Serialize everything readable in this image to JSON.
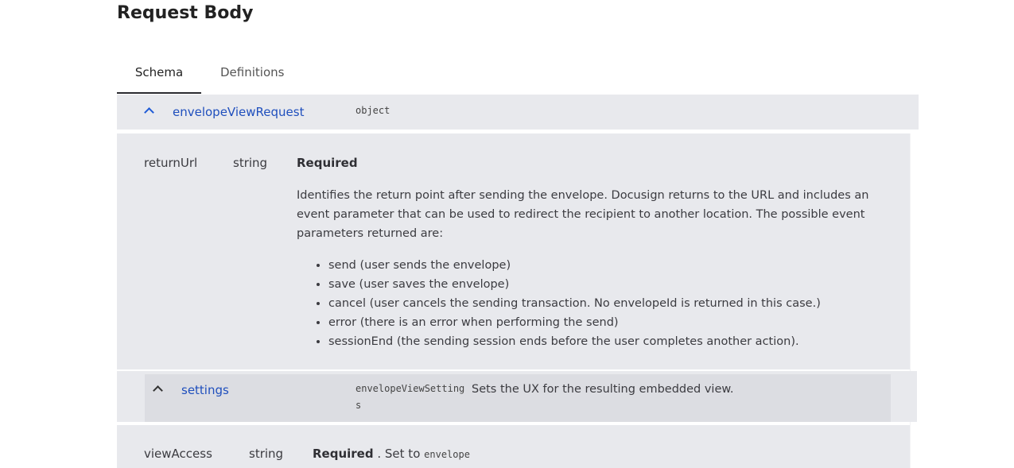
{
  "page": {
    "title": "Request Body"
  },
  "tabs": [
    {
      "label": "Schema",
      "active": true
    },
    {
      "label": "Definitions",
      "active": false
    }
  ],
  "schema": {
    "root": {
      "name": "envelopeViewRequest",
      "type": "object",
      "expanded": true
    },
    "returnUrl": {
      "name": "returnUrl",
      "type": "string",
      "required_label": "Required",
      "description": "Identifies the return point after sending the envelope. Docusign returns to the URL and includes an event parameter that can be used to redirect the recipient to another location. The possible event parameters returned are:",
      "events": [
        "send (user sends the envelope)",
        "save (user saves the envelope)",
        "cancel (user cancels the sending transaction. No envelopeId is returned in this case.)",
        "error (there is an error when performing the send)",
        "sessionEnd (the sending session ends before the user completes another action)."
      ]
    },
    "settings": {
      "name": "settings",
      "type_line1": "envelopeViewSetting",
      "type_line2": "s",
      "description": "Sets the UX for the resulting embedded view.",
      "expanded": true
    },
    "viewAccess": {
      "name": "viewAccess",
      "type": "string",
      "required_label": "Required",
      "set_to_text": ". Set to",
      "value": "envelope"
    }
  },
  "colors": {
    "link": "#1f4fbd",
    "panel": "#e8e9ed",
    "settings_inner": "#dcdde2"
  }
}
